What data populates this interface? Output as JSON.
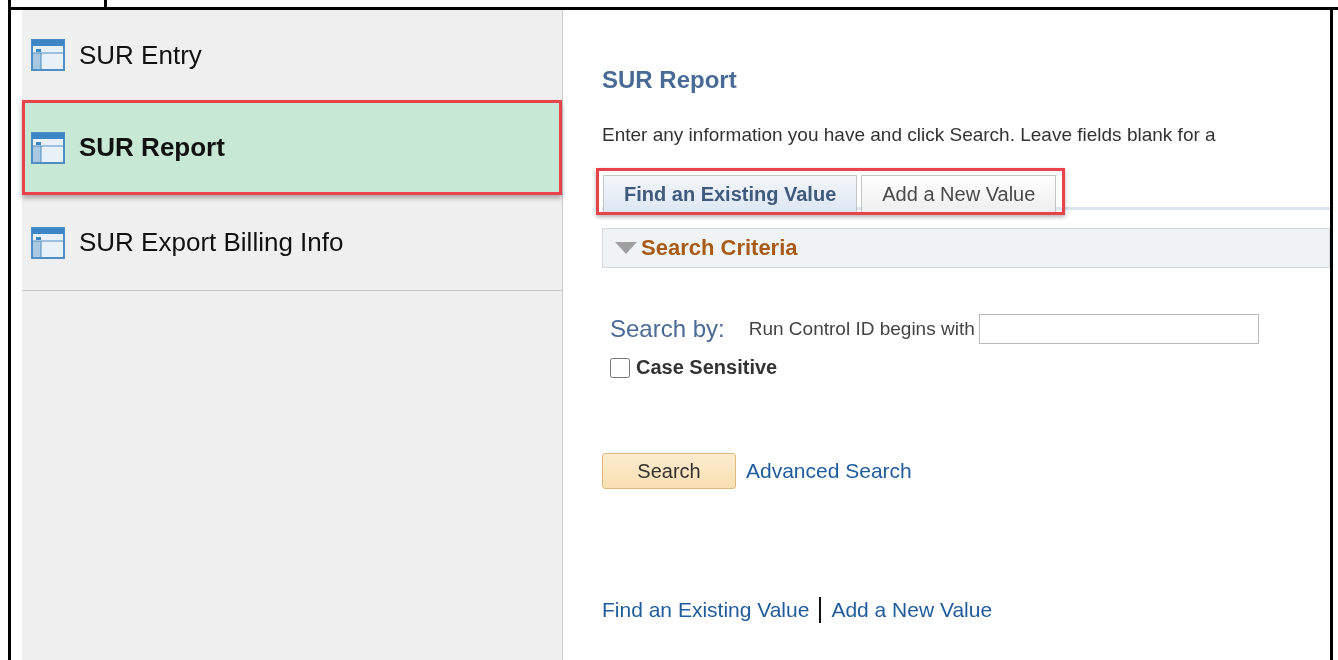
{
  "sidebar": {
    "items": [
      {
        "label": "SUR Entry",
        "selected": false,
        "highlighted": false
      },
      {
        "label": "SUR Report",
        "selected": true,
        "highlighted": true
      },
      {
        "label": "SUR Export Billing Info",
        "selected": false,
        "highlighted": false
      }
    ]
  },
  "page": {
    "title": "SUR Report",
    "instructions": "Enter any information you have and click Search. Leave fields blank for a",
    "tabs_highlighted": true,
    "tabs": [
      {
        "label": "Find an Existing Value",
        "selected": true
      },
      {
        "label": "Add a New Value",
        "selected": false
      }
    ],
    "section": {
      "title": "Search Criteria",
      "expanded": true
    },
    "search_by": {
      "label": "Search by:",
      "field_label": "Run Control ID begins with"
    },
    "case_sensitive": {
      "label": "Case Sensitive",
      "checked": false
    },
    "search_button": "Search",
    "advanced_link": "Advanced Search",
    "footer_links": [
      "Find an Existing Value",
      "Add a New Value"
    ]
  }
}
